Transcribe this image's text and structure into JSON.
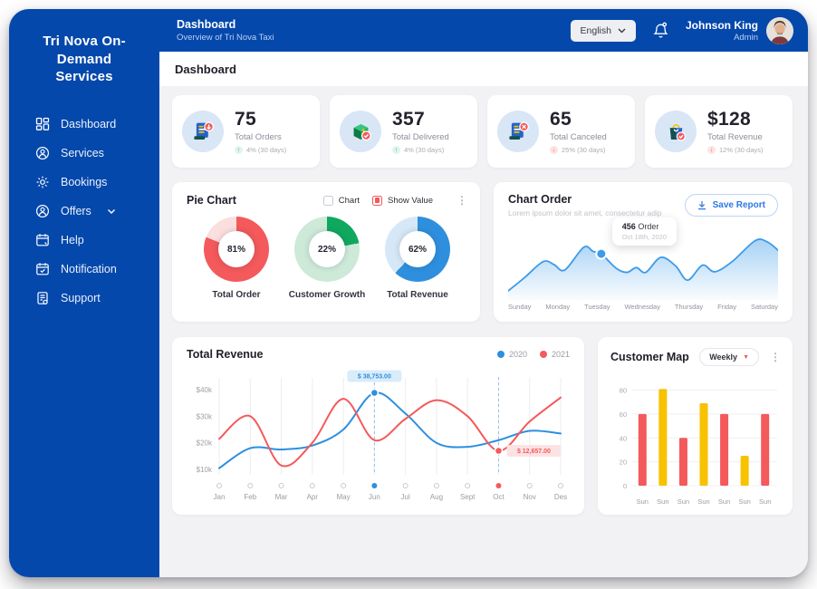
{
  "sidebar": {
    "title": "Tri Nova On-Demand Services",
    "items": [
      {
        "label": "Dashboard",
        "icon": "dashboard-icon"
      },
      {
        "label": "Services",
        "icon": "services-icon"
      },
      {
        "label": "Bookings",
        "icon": "bookings-icon"
      },
      {
        "label": "Offers",
        "icon": "offers-icon"
      },
      {
        "label": "Help",
        "icon": "help-icon"
      },
      {
        "label": "Notification",
        "icon": "notification-icon"
      },
      {
        "label": "Support",
        "icon": "support-icon"
      }
    ]
  },
  "header": {
    "title": "Dashboard",
    "subtitle": "Overview of Tri Nova Taxi",
    "language": "English",
    "user": {
      "name": "Johnson King",
      "role": "Admin"
    }
  },
  "page": {
    "section_title": "Dashboard"
  },
  "stats": [
    {
      "value": "75",
      "label": "Total Orders",
      "trend": "4% (30 days)",
      "trend_dir": "up"
    },
    {
      "value": "357",
      "label": "Total Delivered",
      "trend": "4% (30 days)",
      "trend_dir": "up"
    },
    {
      "value": "65",
      "label": "Total Canceled",
      "trend": "25% (30 days)",
      "trend_dir": "down"
    },
    {
      "value": "$128",
      "label": "Total Revenue",
      "trend": "12% (30 days)",
      "trend_dir": "down"
    }
  ],
  "pie_card": {
    "title": "Pie Chart",
    "chart_checkbox": "Chart",
    "show_value_checkbox": "Show Value"
  },
  "order_card": {
    "title": "Chart Order",
    "subtitle": "Lorem ipsum dolor sit amet, consectetur adip",
    "save_button": "Save Report"
  },
  "revenue_card": {
    "title": "Total Revenue"
  },
  "customer_card": {
    "title": "Customer Map",
    "range": "Weekly"
  },
  "colors": {
    "primary_blue": "#0548AC",
    "chart_blue": "#2E8FDE",
    "chart_red": "#F4595B",
    "chart_yellow": "#F8C200",
    "chart_green": "#10A85F"
  },
  "chart_data": [
    {
      "id": "pie-charts",
      "type": "pie",
      "title": "Pie Chart",
      "items": [
        {
          "label": "Total Order",
          "value": 81,
          "value_label": "81%",
          "color": "#F4595B",
          "track": "#FBDEDE"
        },
        {
          "label": "Customer Growth",
          "value": 22,
          "value_label": "22%",
          "color": "#10A85F",
          "track": "#CDEAD9"
        },
        {
          "label": "Total Revenue",
          "value": 62,
          "value_label": "62%",
          "color": "#2E8FDE",
          "track": "#D6E8F7"
        }
      ]
    },
    {
      "id": "chart-order",
      "type": "area",
      "title": "Chart Order",
      "x": [
        "Sunday",
        "Monday",
        "Tuesday",
        "Wednesday",
        "Thursday",
        "Friday",
        "Saturday"
      ],
      "points": [
        [
          0,
          6
        ],
        [
          0.06,
          28
        ],
        [
          0.13,
          55
        ],
        [
          0.17,
          50
        ],
        [
          0.21,
          41
        ],
        [
          0.28,
          79
        ],
        [
          0.315,
          72
        ],
        [
          0.345,
          68
        ],
        [
          0.4,
          44
        ],
        [
          0.44,
          37
        ],
        [
          0.475,
          45
        ],
        [
          0.51,
          37
        ],
        [
          0.565,
          62
        ],
        [
          0.62,
          48
        ],
        [
          0.665,
          24
        ],
        [
          0.72,
          49
        ],
        [
          0.765,
          38
        ],
        [
          0.83,
          55
        ],
        [
          0.915,
          90
        ],
        [
          0.96,
          88
        ],
        [
          1,
          74
        ]
      ],
      "marker": {
        "fx": 0.345,
        "v": 68
      },
      "tooltip": {
        "value": "456",
        "unit": "Order",
        "date": "Oct 18th, 2020"
      },
      "color": "#3D9BE9"
    },
    {
      "id": "total-revenue",
      "type": "line",
      "title": "Total Revenue",
      "x": [
        "Jan",
        "Feb",
        "Mar",
        "Apr",
        "May",
        "Jun",
        "Jul",
        "Aug",
        "Sept",
        "Oct",
        "Nov",
        "Des"
      ],
      "ylim": [
        8,
        42
      ],
      "yticks": [
        {
          "v": 40,
          "label": "$40k"
        },
        {
          "v": 30,
          "label": "$30k"
        },
        {
          "v": 20,
          "label": "$20k"
        },
        {
          "v": 10,
          "label": "$10k"
        }
      ],
      "series": [
        {
          "name": "2020",
          "color": "#2E8FDE",
          "values": [
            10.5,
            18,
            17.5,
            19,
            25,
            38.75,
            31,
            20,
            18.5,
            21,
            24.5,
            23.5
          ]
        },
        {
          "name": "2021",
          "color": "#F4595B",
          "values": [
            21.5,
            30,
            11.5,
            20,
            36.5,
            21,
            29,
            36,
            30,
            17,
            28,
            37
          ]
        }
      ],
      "dashed_x": [
        5,
        9
      ],
      "annotations": [
        {
          "series": 0,
          "x_index": 5,
          "value": 38.75,
          "label": "$ 38,753.00"
        },
        {
          "series": 1,
          "x_index": 9,
          "value": 17,
          "label": "$ 12,657.00"
        }
      ]
    },
    {
      "id": "customer-map",
      "type": "bar",
      "title": "Customer Map",
      "x": [
        "Sun",
        "Sun",
        "Sun",
        "Sun",
        "Sun",
        "Sun",
        "Sun"
      ],
      "values": [
        60,
        81,
        40,
        69,
        60,
        25,
        60
      ],
      "bar_colors": [
        "#F4595B",
        "#F8C200"
      ],
      "yticks": [
        0,
        20,
        40,
        60,
        80
      ],
      "ylim": [
        0,
        88
      ]
    }
  ]
}
